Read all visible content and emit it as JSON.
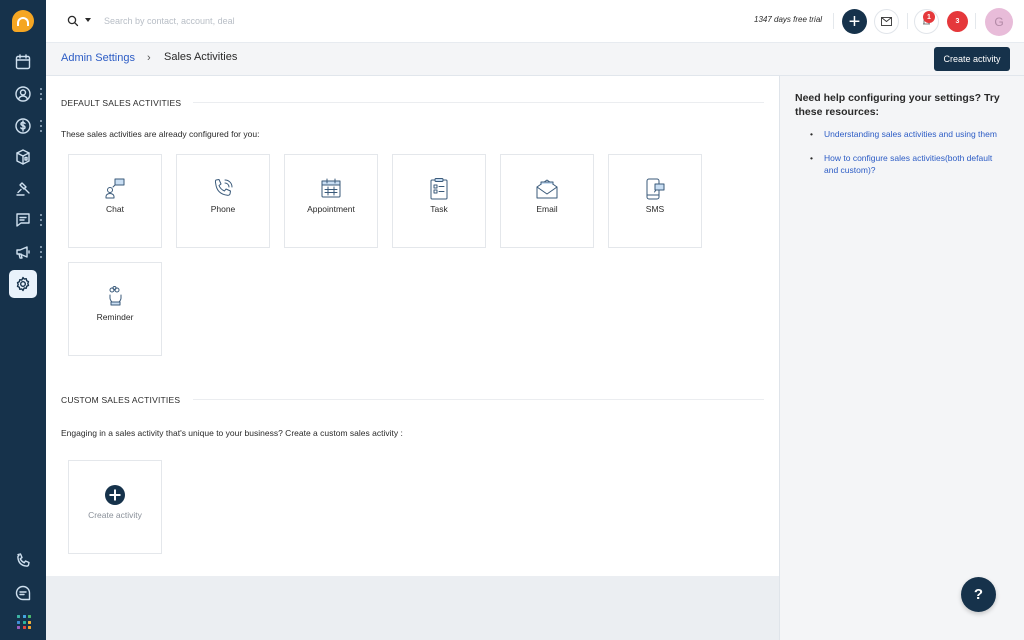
{
  "sidenav": {
    "logo": "freshsales-logo",
    "items": [
      {
        "name": "calendar",
        "icon": "calendar-icon",
        "has_more": false,
        "active": false
      },
      {
        "name": "contacts",
        "icon": "contact-icon",
        "has_more": true,
        "active": false
      },
      {
        "name": "deals",
        "icon": "dollar-icon",
        "has_more": true,
        "active": false
      },
      {
        "name": "products",
        "icon": "cube-icon",
        "has_more": false,
        "active": false
      },
      {
        "name": "cpq",
        "icon": "gavel-icon",
        "has_more": false,
        "active": false
      },
      {
        "name": "conversations",
        "icon": "chat-icon",
        "has_more": true,
        "active": false
      },
      {
        "name": "campaigns",
        "icon": "megaphone-icon",
        "has_more": true,
        "active": false
      },
      {
        "name": "settings",
        "icon": "gear-icon",
        "has_more": false,
        "active": true
      }
    ],
    "bottom_items": [
      {
        "name": "phone",
        "icon": "phone-icon"
      },
      {
        "name": "chat",
        "icon": "chat-bubble-icon"
      },
      {
        "name": "apps",
        "icon": "apps-grid-icon"
      }
    ],
    "apps_colors": [
      "#3cb4a5",
      "#45a6e0",
      "#4cbb6b",
      "#3d8fd6",
      "#2ab5a0",
      "#f2b23a",
      "#9c5fbf",
      "#e5483d",
      "#f0a22f"
    ]
  },
  "topbar": {
    "search_placeholder": "Search by contact, account, deal",
    "trial_text": "1347 days free trial",
    "notification_count": "1",
    "alert_count": "3",
    "avatar_initial": "G"
  },
  "header": {
    "breadcrumb_parent": "Admin Settings",
    "breadcrumb_separator": "›",
    "breadcrumb_current": "Sales Activities",
    "create_button": "Create activity"
  },
  "default_section": {
    "title": "DEFAULT SALES ACTIVITIES",
    "description": "These sales activities are already configured for you:",
    "activities": [
      {
        "label": "Chat",
        "icon": "chat-person-icon"
      },
      {
        "label": "Phone",
        "icon": "phone-icon"
      },
      {
        "label": "Appointment",
        "icon": "calendar-icon"
      },
      {
        "label": "Task",
        "icon": "clipboard-icon"
      },
      {
        "label": "Email",
        "icon": "envelope-open-icon"
      },
      {
        "label": "SMS",
        "icon": "mobile-message-icon"
      },
      {
        "label": "Reminder",
        "icon": "finger-string-icon"
      }
    ]
  },
  "custom_section": {
    "title": "CUSTOM SALES ACTIVITIES",
    "description": "Engaging in a sales activity that's unique to your business? Create a custom sales activity :",
    "create_label": "Create activity"
  },
  "help": {
    "title": "Need help configuring your settings? Try these resources:",
    "links": [
      "Understanding sales activities and using them",
      "How to configure sales activities(both default and custom)?"
    ],
    "fab_label": "?"
  }
}
